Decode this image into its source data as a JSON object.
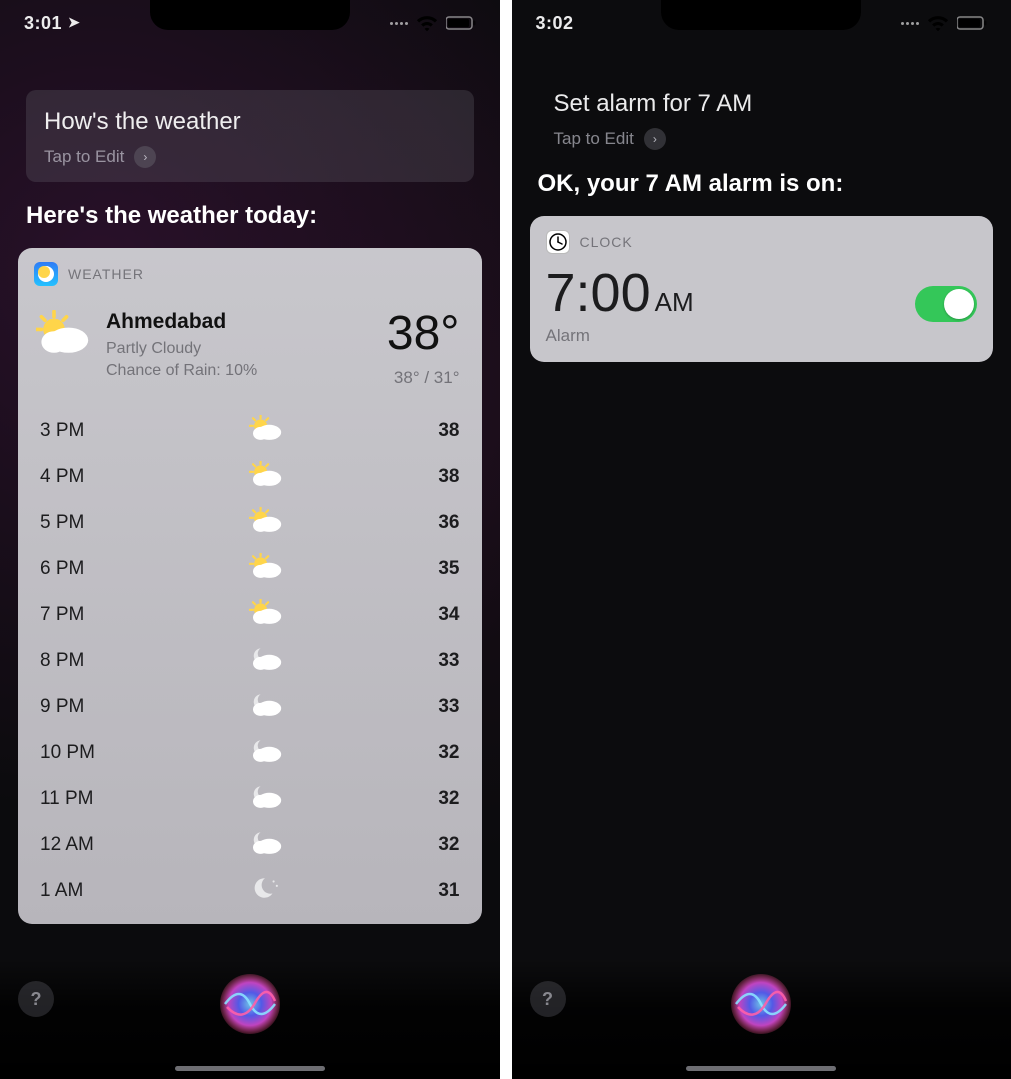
{
  "left": {
    "statusbar": {
      "time": "3:01",
      "show_location": true
    },
    "query": "How's the weather",
    "tap_to_edit": "Tap to Edit",
    "response": "Here's the weather today:",
    "card": {
      "app_label": "WEATHER",
      "location": "Ahmedabad",
      "condition": "Partly Cloudy",
      "rain_line": "Chance of Rain: 10%",
      "temp": "38°",
      "hilo": "38° / 31°",
      "hourly": [
        {
          "time": "3 PM",
          "icon": "sun-cloud",
          "temp": "38"
        },
        {
          "time": "4 PM",
          "icon": "sun-cloud",
          "temp": "38"
        },
        {
          "time": "5 PM",
          "icon": "sun-cloud",
          "temp": "36"
        },
        {
          "time": "6 PM",
          "icon": "sun-cloud",
          "temp": "35"
        },
        {
          "time": "7 PM",
          "icon": "sun-cloud",
          "temp": "34"
        },
        {
          "time": "8 PM",
          "icon": "moon-cloud",
          "temp": "33"
        },
        {
          "time": "9 PM",
          "icon": "moon-cloud",
          "temp": "33"
        },
        {
          "time": "10 PM",
          "icon": "moon-cloud",
          "temp": "32"
        },
        {
          "time": "11 PM",
          "icon": "moon-cloud",
          "temp": "32"
        },
        {
          "time": "12 AM",
          "icon": "moon-cloud",
          "temp": "32"
        },
        {
          "time": "1 AM",
          "icon": "moon",
          "temp": "31"
        }
      ]
    }
  },
  "right": {
    "statusbar": {
      "time": "3:02",
      "show_location": false
    },
    "query": "Set alarm for 7 AM",
    "tap_to_edit": "Tap to Edit",
    "response": "OK, your 7 AM alarm is on:",
    "card": {
      "app_label": "CLOCK",
      "time": "7:00",
      "ampm": "AM",
      "label": "Alarm",
      "toggle_on": true
    }
  },
  "help_glyph": "?"
}
